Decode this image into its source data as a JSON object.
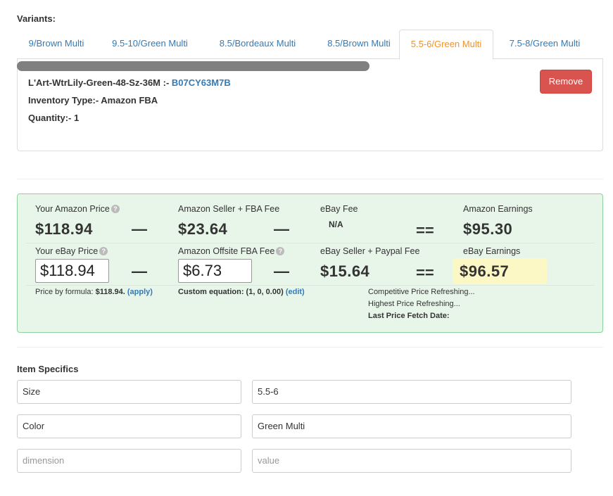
{
  "variants": {
    "label": "Variants:",
    "tabs": [
      {
        "label": "9/Brown Multi"
      },
      {
        "label": "9.5-10/Green Multi"
      },
      {
        "label": "8.5/Bordeaux Multi"
      },
      {
        "label": "8.5/Brown Multi"
      },
      {
        "label": "5.5-6/Green Multi",
        "active": true
      },
      {
        "label": "7.5-8/Green Multi"
      }
    ],
    "selected": {
      "sku_prefix": "L'Art-WtrLily-Green-48-Sz-36M :- ",
      "asin": "B07CY63M7B",
      "inventory_type": "Inventory Type:- Amazon FBA",
      "quantity": "Quantity:- 1",
      "remove_label": "Remove"
    }
  },
  "pricing": {
    "amazon_price_label": "Your Amazon Price",
    "amazon_price": "$118.94",
    "seller_fba_fee_label": "Amazon Seller + FBA Fee",
    "seller_fba_fee": "$23.64",
    "ebay_fee_label": "eBay Fee",
    "ebay_fee": "N/A",
    "amazon_earnings_label": "Amazon Earnings",
    "amazon_earnings": "$95.30",
    "ebay_price_label": "Your eBay Price",
    "ebay_price": "$118.94",
    "offsite_fba_fee_label": "Amazon Offsite FBA Fee",
    "offsite_fba_fee": "$6.73",
    "ebay_seller_paypal_label": "eBay Seller + Paypal Fee",
    "ebay_seller_paypal": "$15.64",
    "ebay_earnings_label": "eBay Earnings",
    "ebay_earnings": "$96.57",
    "minus": "—",
    "equals": "==",
    "help": "?",
    "formula_label": "Price by formula: ",
    "formula_value": "$118.94.",
    "apply_label": "(apply)",
    "custom_eq_label": "Custom equation: (1, 0, 0.00)",
    "edit_label": "(edit)",
    "competitive_refresh": "Competitive Price Refreshing...",
    "highest_refresh": "Highest Price Refreshing...",
    "last_fetch": "Last Price Fetch Date:"
  },
  "item_specifics": {
    "label": "Item Specifics",
    "rows": [
      {
        "name": "Size",
        "value": "5.5-6"
      },
      {
        "name": "Color",
        "value": "Green Multi"
      }
    ],
    "placeholder_name": "dimension",
    "placeholder_value": "value"
  }
}
